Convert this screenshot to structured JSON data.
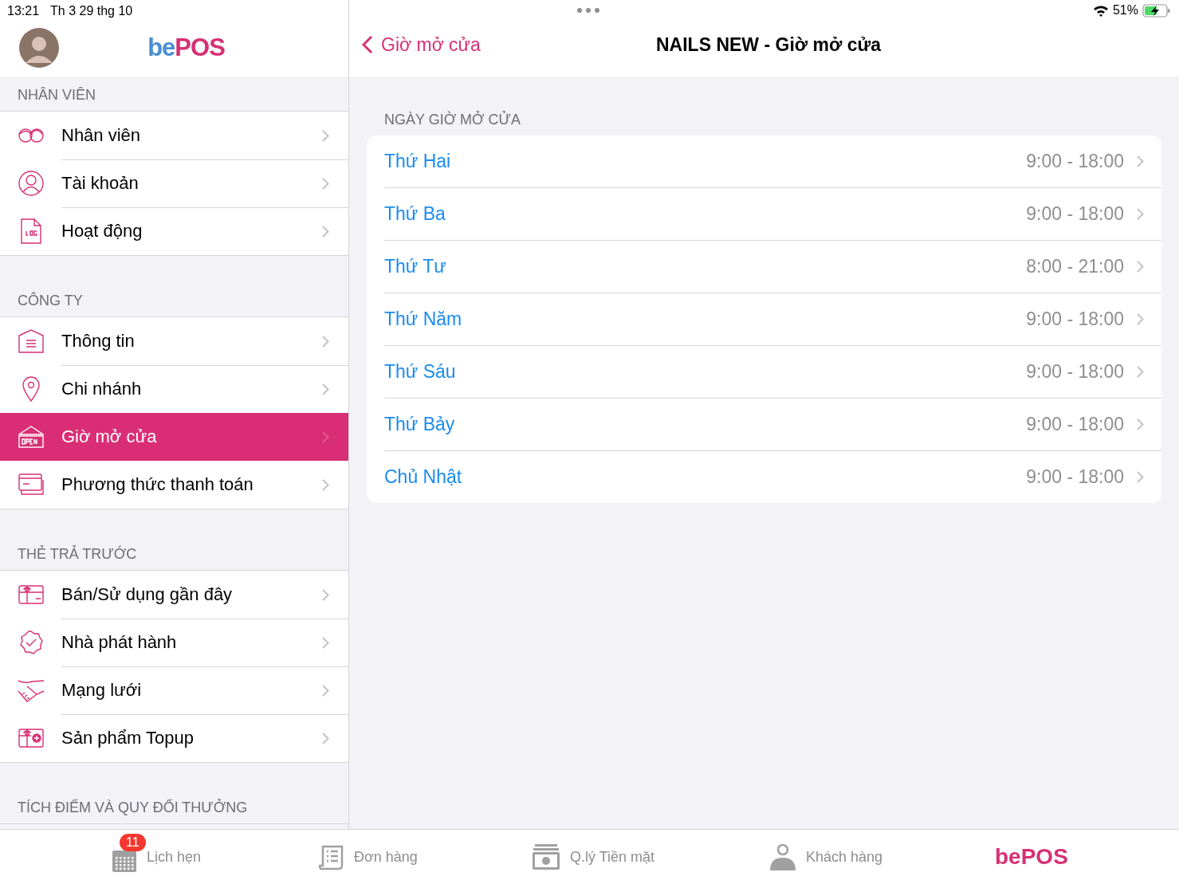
{
  "status_bar": {
    "time": "13:21",
    "date": "Th 3 29 thg 10",
    "battery": "51%"
  },
  "sidebar": {
    "logo": {
      "prefix": "be",
      "suffix": "POS"
    },
    "sections": [
      {
        "title": "NHÂN VIÊN",
        "items": [
          {
            "label": "Nhân viên",
            "selected": false
          },
          {
            "label": "Tài khoản",
            "selected": false
          },
          {
            "label": "Hoạt động",
            "selected": false
          }
        ]
      },
      {
        "title": "CÔNG TY",
        "items": [
          {
            "label": "Thông tin",
            "selected": false
          },
          {
            "label": "Chi nhánh",
            "selected": false
          },
          {
            "label": "Giờ mở cửa",
            "selected": true
          },
          {
            "label": "Phương thức thanh toán",
            "selected": false
          }
        ]
      },
      {
        "title": "THẺ TRẢ TRƯỚC",
        "items": [
          {
            "label": "Bán/Sử dụng gần đây",
            "selected": false
          },
          {
            "label": "Nhà phát hành",
            "selected": false
          },
          {
            "label": "Mạng lưới",
            "selected": false
          },
          {
            "label": "Sản phẩm Topup",
            "selected": false
          }
        ]
      },
      {
        "title": "TÍCH ĐIỂM VÀ QUY ĐỔI THƯỞNG"
      }
    ]
  },
  "detail": {
    "back_label": "Giờ mở cửa",
    "title": "NAILS NEW - Giờ mở cửa",
    "section_title": "NGÀY GIỜ MỞ CỬA",
    "days": [
      {
        "day": "Thứ Hai",
        "hours": "9:00 - 18:00"
      },
      {
        "day": "Thứ Ba",
        "hours": "9:00 - 18:00"
      },
      {
        "day": "Thứ Tư",
        "hours": "8:00 - 21:00"
      },
      {
        "day": "Thứ Năm",
        "hours": "9:00 - 18:00"
      },
      {
        "day": "Thứ Sáu",
        "hours": "9:00 - 18:00"
      },
      {
        "day": "Thứ Bảy",
        "hours": "9:00 - 18:00"
      },
      {
        "day": "Chủ Nhật",
        "hours": "9:00 - 18:00"
      }
    ]
  },
  "tab_bar": [
    {
      "kind": "calendar",
      "label": "Lịch hẹn",
      "badge": "11",
      "selected": false
    },
    {
      "kind": "orders",
      "label": "Đơn hàng",
      "selected": false
    },
    {
      "kind": "cash",
      "label": "Q.lý Tiền mặt",
      "selected": false
    },
    {
      "kind": "customer",
      "label": "Khách hàng",
      "selected": false
    },
    {
      "kind": "brand",
      "label": "bePOS",
      "selected": true
    }
  ]
}
